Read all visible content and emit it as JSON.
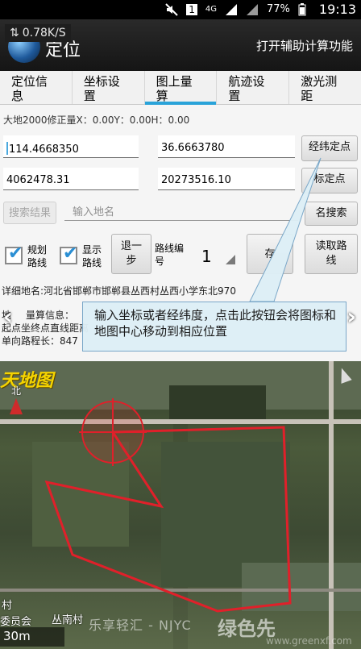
{
  "status_bar": {
    "network": "4G",
    "battery": "77%",
    "time": "19:13",
    "sim": "1"
  },
  "speed_overlay": {
    "value": "0.78K/S"
  },
  "app": {
    "title": "定位",
    "aux_action": "打开辅助计算功能"
  },
  "tabs": [
    {
      "label": "定位信\n息"
    },
    {
      "label": "坐标设\n置"
    },
    {
      "label": "图上量\n算",
      "active": true
    },
    {
      "label": "航迹设\n置"
    },
    {
      "label": "激光测\n距"
    }
  ],
  "correction_text": "大地2000修正量X：0.00Y：0.00H：0.00",
  "coords": {
    "longitude": "114.4668350",
    "latitude": "36.6663780",
    "x": "4062478.31",
    "y": "20273516.10",
    "btn_lonlat": "经纬定点",
    "btn_xy": "标定点"
  },
  "search": {
    "results_button": "搜索结果",
    "placeholder": "输入地名",
    "search_button": "名搜索"
  },
  "route": {
    "plan_label": "规划\n路线",
    "show_label": "显示\n路线",
    "undo_button": "退一\n步",
    "route_no_label": "路线编\n号",
    "route_no": "1",
    "save_button": "存",
    "read_button": "读取路\n线"
  },
  "detail_address": "详细地名:河北省邯郸市邯郸县丛西村丛西小学东北970",
  "calc_info": {
    "line1": "地",
    "line1b": "量算信息：",
    "line2": "起点",
    "line2b": "坐终点直线距离",
    "line3": "单向路程长：847"
  },
  "tooltip": "输入坐标或者经纬度，点击此按钮会将图标和地图中心移动到相应位置",
  "map": {
    "brand": "天地图",
    "north": "北",
    "place1": "村",
    "place2": "委员会",
    "place3": "丛南村",
    "scale": "30m",
    "watermark": "乐享轻汇 - NJYC",
    "watermark_logo": "绿色先",
    "watermark_url": "www.greenxf.com"
  },
  "colors": {
    "accent": "#2aa3d9",
    "route": "#e0202a"
  }
}
